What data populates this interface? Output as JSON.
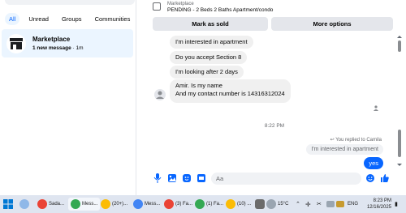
{
  "filters": [
    {
      "label": "All",
      "active": true
    },
    {
      "label": "Unread",
      "active": false
    },
    {
      "label": "Groups",
      "active": false
    },
    {
      "label": "Communities",
      "active": false
    }
  ],
  "conversation": {
    "name": "Marketplace",
    "subtitle_bold": "1 new message",
    "subtitle_rest": " · 1m"
  },
  "listing": {
    "label": "Marketplace",
    "status": "PENDING - 2 Beds 2 Baths Apartment/condo"
  },
  "actions": {
    "mark_sold": "Mark as sold",
    "more_options": "More options"
  },
  "messages": {
    "in": [
      "I'm interested in apartment",
      "Do you accept  Section 8",
      "I'm looking after 2 days"
    ],
    "in_multi_line1": "Amir. Is my name",
    "in_multi_line2": "And my contact number is 14316312024",
    "time": "8:22 PM",
    "replied": "You replied to Camila",
    "quoted": "I'm interested in apartment",
    "yes": "yes"
  },
  "composer": {
    "placeholder": "Aa"
  },
  "taskbar": {
    "items": [
      {
        "label": "Sada...",
        "color": "#ea4335"
      },
      {
        "label": "Mess...",
        "color": "#34a853"
      },
      {
        "label": "(20+)...",
        "color": "#fbbc05"
      },
      {
        "label": "Mess...",
        "color": "#4285f4"
      },
      {
        "label": "(3) Fa...",
        "color": "#ea4335"
      },
      {
        "label": "(1) Fa...",
        "color": "#34a853"
      },
      {
        "label": "(10) ...",
        "color": "#fbbc05"
      }
    ],
    "weather": "15°C",
    "lang": "ENG",
    "time": "8:23 PM",
    "date": "12/16/2025"
  },
  "colors": {
    "accent": "#0866ff",
    "selected_bg": "#ebf5ff",
    "bubble_bg": "#f0f0f0"
  }
}
